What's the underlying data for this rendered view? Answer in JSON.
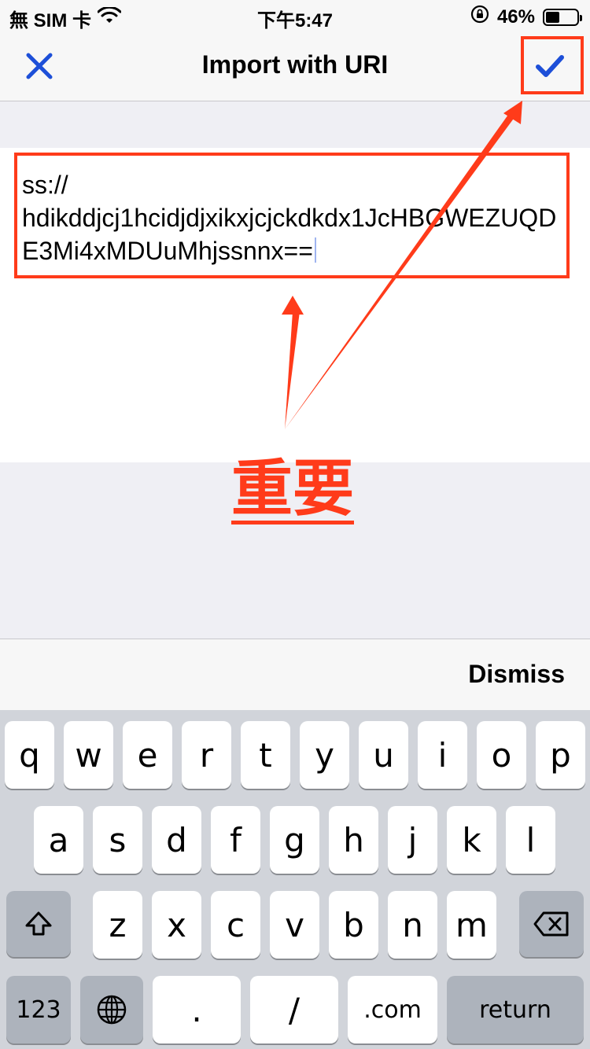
{
  "status_bar": {
    "carrier": "無 SIM 卡",
    "time": "下午5:47",
    "battery_percent": "46%",
    "battery_level": 0.46
  },
  "nav": {
    "title": "Import with URI"
  },
  "uri": {
    "value": "ss://\nhdikddjcj1hcidjdjxikxjcjckdkdx1JcHBGWEZUQDE3Mi4xMDUuMhjssnnx=="
  },
  "annotation": {
    "label": "重要",
    "color": "#ff3b1a"
  },
  "accessory": {
    "dismiss": "Dismiss"
  },
  "keyboard": {
    "row1": [
      "q",
      "w",
      "e",
      "r",
      "t",
      "y",
      "u",
      "i",
      "o",
      "p"
    ],
    "row2": [
      "a",
      "s",
      "d",
      "f",
      "g",
      "h",
      "j",
      "k",
      "l"
    ],
    "row3": [
      "z",
      "x",
      "c",
      "v",
      "b",
      "n",
      "m"
    ],
    "bottom": {
      "numbers": "123",
      "dot": ".",
      "slash": "/",
      "dotcom": ".com",
      "return": "return"
    }
  }
}
